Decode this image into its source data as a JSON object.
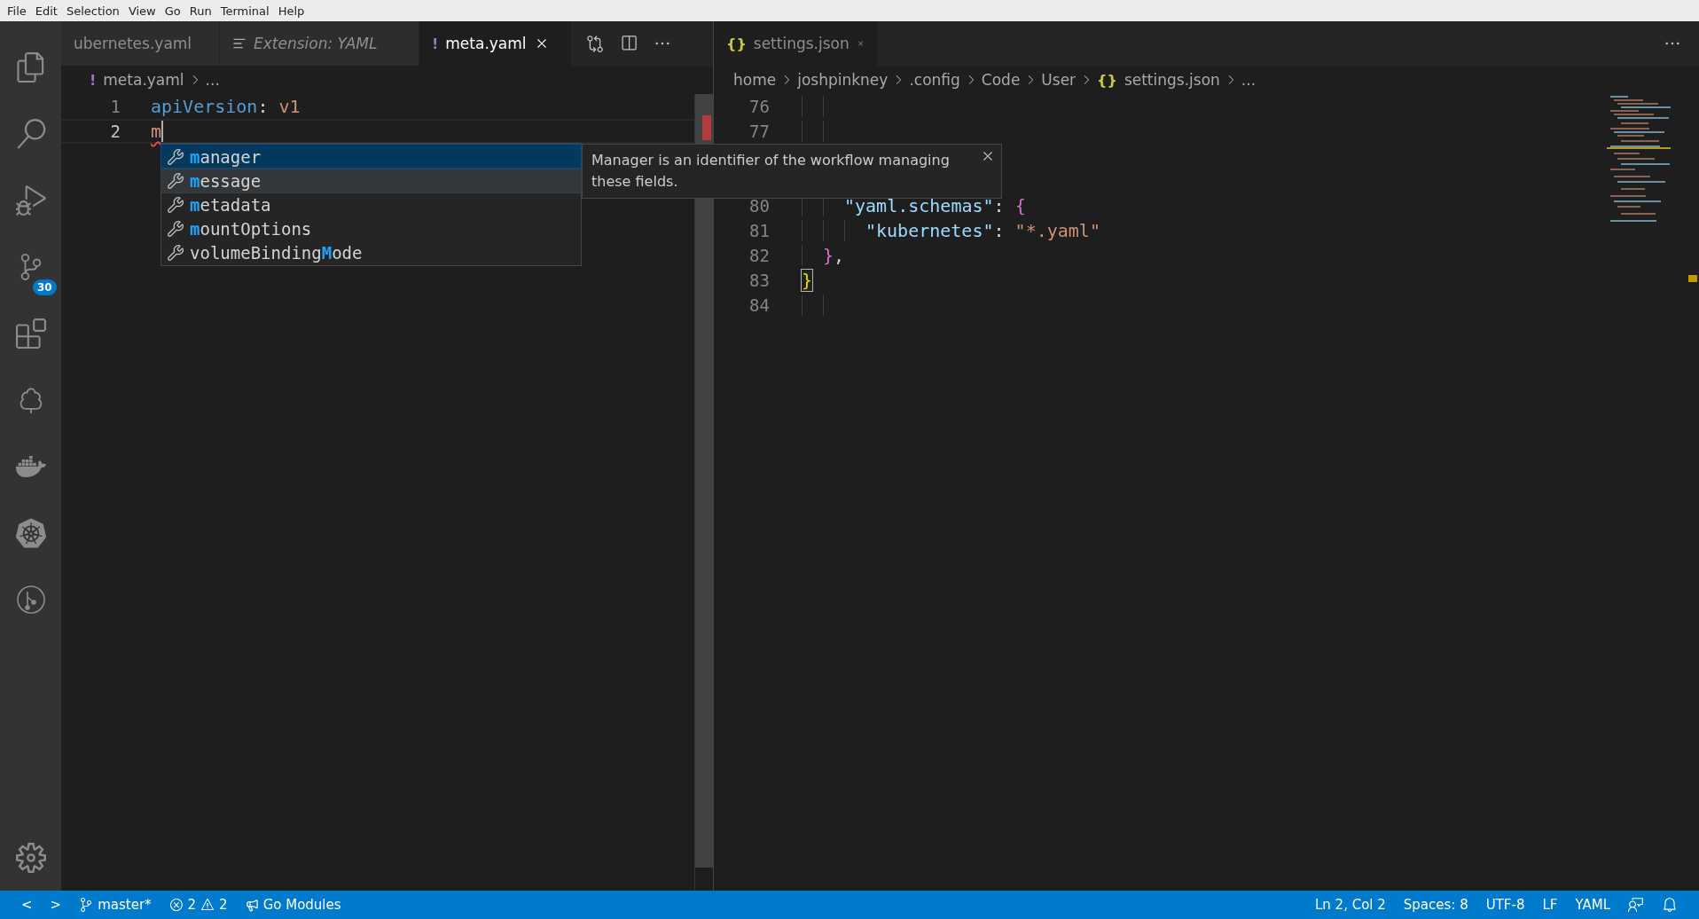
{
  "menu": [
    {
      "label": "File"
    },
    {
      "label": "Edit"
    },
    {
      "label": "Selection"
    },
    {
      "label": "View"
    },
    {
      "label": "Go"
    },
    {
      "label": "Run"
    },
    {
      "label": "Terminal"
    },
    {
      "label": "Help"
    }
  ],
  "activity_bar": {
    "badge": "30"
  },
  "left_group": {
    "focused": true,
    "tabs": [
      {
        "kind": "none",
        "label": "ubernetes.yaml",
        "selected": false,
        "preview": false
      },
      {
        "kind": "preview",
        "label": "Extension: YAML",
        "selected": false,
        "preview": true
      },
      {
        "kind": "glyph",
        "glyph": "!",
        "label": "meta.yaml",
        "selected": true,
        "preview": false
      }
    ],
    "breadcrumb": [
      {
        "glyph": "!",
        "label": "meta.yaml"
      },
      {
        "label": "..."
      }
    ],
    "lines": [
      {
        "number": "1",
        "current": false,
        "tokens": [
          {
            "kind": "yaml-key",
            "text": "apiVersion"
          },
          {
            "kind": "plain",
            "text": ": "
          },
          {
            "kind": "yaml-value",
            "text": "v1"
          }
        ]
      },
      {
        "number": "2",
        "current": true,
        "tokens": [
          {
            "kind": "error",
            "text": "m"
          }
        ]
      }
    ]
  },
  "right_group": {
    "focused": false,
    "tabs": [
      {
        "kind": "glyph",
        "glyph": "{}",
        "label": "settings.json",
        "selected": true,
        "preview": false
      }
    ],
    "breadcrumb": [
      {
        "label": "home"
      },
      {
        "label": "joshpinkney"
      },
      {
        "label": ".config"
      },
      {
        "label": "Code"
      },
      {
        "label": "User"
      },
      {
        "glyph": "{}",
        "label": "settings.json"
      },
      {
        "label": "..."
      }
    ],
    "lines_above": [
      {
        "number": "76",
        "current": false
      },
      {
        "number": "77",
        "current": false
      }
    ],
    "lines_below": [
      {
        "number": "80",
        "current": false,
        "tokens": [
          {
            "kind": "json-key",
            "text": "    \"yaml.schemas\""
          },
          {
            "kind": "plain",
            "text": ": "
          },
          {
            "kind": "bracket",
            "text": "{"
          }
        ]
      },
      {
        "number": "81",
        "current": false,
        "tokens": [
          {
            "kind": "json-key",
            "text": "      \"kubernetes\""
          },
          {
            "kind": "plain",
            "text": ": "
          },
          {
            "kind": "json-string",
            "text": "\"*.yaml\""
          }
        ]
      },
      {
        "number": "82",
        "current": false,
        "tokens": [
          {
            "kind": "bracket",
            "text": "  }"
          },
          {
            "kind": "plain",
            "text": ","
          }
        ]
      },
      {
        "number": "83",
        "current": false,
        "tokens": [
          {
            "kind": "bracket-match",
            "text": "}"
          }
        ]
      },
      {
        "number": "84",
        "current": false
      }
    ]
  },
  "suggestions": [
    {
      "match": "m",
      "suffix": "anager",
      "selected": true,
      "hovered": false
    },
    {
      "match": "m",
      "suffix": "essage",
      "selected": false,
      "hovered": true
    },
    {
      "match": "m",
      "suffix": "etadata",
      "selected": false,
      "hovered": false
    },
    {
      "match": "m",
      "suffix": "ountOptions",
      "selected": false,
      "hovered": false
    },
    {
      "prefix": "volumeBinding",
      "match": "M",
      "suffix": "ode",
      "selected": false,
      "hovered": false
    }
  ],
  "details": {
    "text": "Manager is an identifier of the workflow managing these fields."
  },
  "status_bar": {
    "left": [
      {
        "kind": "nav",
        "label": "<"
      },
      {
        "kind": "nav",
        "label": ">"
      },
      {
        "kind": "branch",
        "label": "master*"
      },
      {
        "kind": "problems",
        "errors": "2",
        "warnings": "2"
      },
      {
        "kind": "megaphone",
        "label": "Go Modules"
      }
    ],
    "right": [
      {
        "kind": "text",
        "label": "Ln 2, Col 2"
      },
      {
        "kind": "text",
        "label": "Spaces: 8"
      },
      {
        "kind": "text",
        "label": "UTF-8"
      },
      {
        "kind": "text",
        "label": "LF"
      },
      {
        "kind": "text",
        "label": "YAML"
      },
      {
        "kind": "feedback"
      },
      {
        "kind": "bell"
      }
    ]
  }
}
